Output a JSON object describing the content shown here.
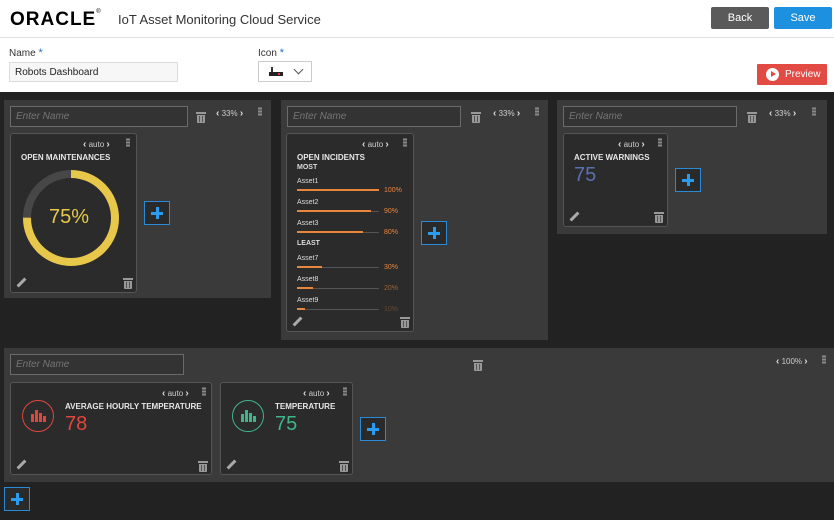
{
  "header": {
    "logo": "ORACLE",
    "logo_reg": "®",
    "app_title": "IoT Asset Monitoring Cloud Service",
    "back_label": "Back",
    "save_label": "Save"
  },
  "form": {
    "name_label": "Name",
    "name_value": "Robots Dashboard",
    "icon_label": "Icon",
    "required_mark": "*",
    "selected_icon": "router-icon",
    "preview_label": "Preview"
  },
  "colors": {
    "accent": "#1e90e0",
    "preview": "#e24a44",
    "gauge": "#e8c84a",
    "incident_bar": "#e9863d",
    "warning_value": "#5a6fb0",
    "avg_temp": "#e0463e",
    "temperature": "#3fb58a"
  },
  "name_placeholder": "Enter Name",
  "columns": [
    {
      "size": "33%",
      "cards": [
        {
          "size": "auto",
          "title": "OPEN MAINTENANCES",
          "gauge_percent": 75,
          "gauge_label": "75%"
        }
      ]
    },
    {
      "size": "33%",
      "cards": [
        {
          "size": "auto",
          "title": "OPEN INCIDENTS",
          "most_label": "MOST",
          "least_label": "LEAST",
          "most": [
            {
              "name": "Asset1",
              "percent": 100,
              "label": "100%"
            },
            {
              "name": "Asset2",
              "percent": 90,
              "label": "90%"
            },
            {
              "name": "Asset3",
              "percent": 80,
              "label": "80%"
            }
          ],
          "least": [
            {
              "name": "Asset7",
              "percent": 30,
              "label": "30%"
            },
            {
              "name": "Asset8",
              "percent": 20,
              "label": "20%"
            },
            {
              "name": "Asset9",
              "percent": 10,
              "label": "10%"
            }
          ]
        }
      ]
    },
    {
      "size": "33%",
      "cards": [
        {
          "size": "auto",
          "title": "ACTIVE WARNINGS",
          "value": "75"
        }
      ]
    }
  ],
  "row": {
    "size": "100%",
    "cards": [
      {
        "size": "auto",
        "title": "AVERAGE HOURLY TEMPERATURE",
        "value": "78",
        "icon": "bar-chart-icon"
      },
      {
        "size": "auto",
        "title": "TEMPERATURE",
        "value": "75",
        "icon": "bar-chart-icon"
      }
    ]
  }
}
